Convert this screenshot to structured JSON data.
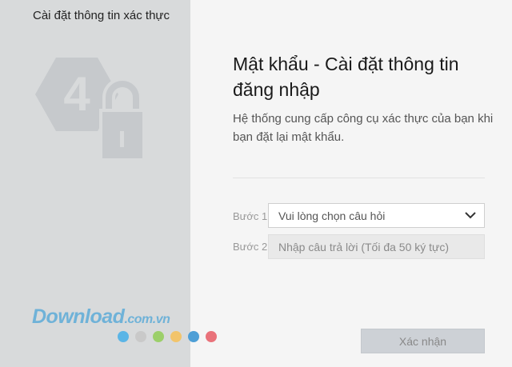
{
  "left_panel": {
    "title": "Cài đặt thông tin xác thực",
    "icon": "lock-badge-icon",
    "badge_number": "4"
  },
  "main": {
    "title": "Mật khẩu - Cài đặt thông tin đăng nhập",
    "description": "Hệ thống cung cấp công cụ xác thực của bạn khi bạn đặt lại mật khẩu."
  },
  "form": {
    "step1_label": "Bước 1",
    "question_select_value": "Vui lòng chọn câu hỏi",
    "step2_label": "Bước 2",
    "answer_placeholder": "Nhập câu trả lời (Tối đa 50 ký tực)",
    "confirm_label": "Xác nhận"
  },
  "watermark": {
    "brand": "Download",
    "suffix": ".com.vn",
    "dot_colors": [
      "#5bb5e6",
      "#c9c9c9",
      "#9ccf6a",
      "#f2c46b",
      "#4e9fd6",
      "#e9727a"
    ]
  }
}
